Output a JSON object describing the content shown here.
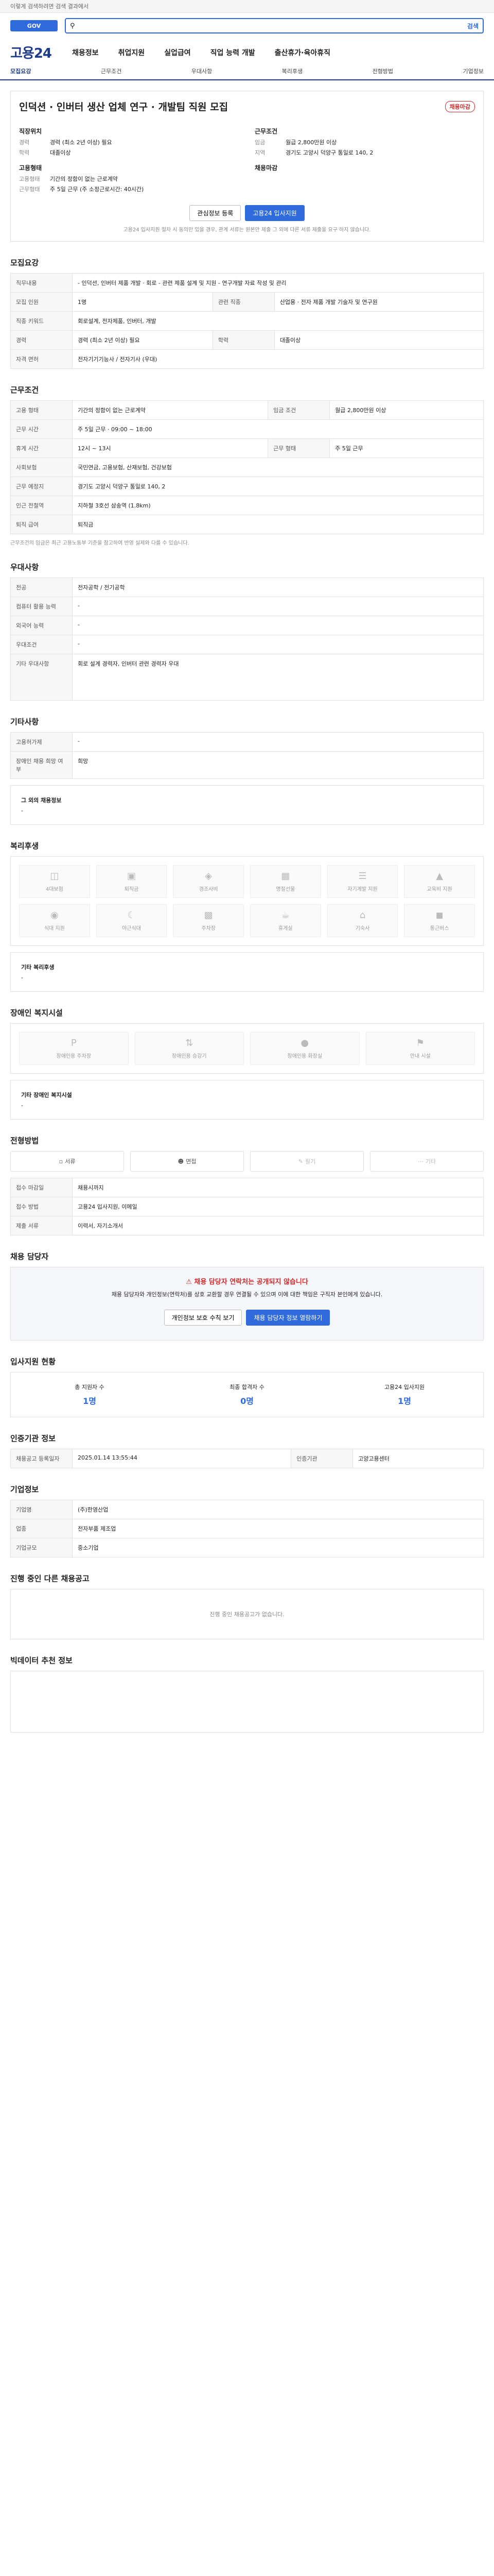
{
  "top_banner": "이렇게 검색하려면 검색 결과에서",
  "search": {
    "button_label": "검색",
    "placeholder": ""
  },
  "brand": "고용24",
  "gnb": [
    "채용정보",
    "취업지원",
    "실업급여",
    "직업 능력 개발",
    "출산휴가·육아휴직"
  ],
  "subnav": [
    "모집요강",
    "근무조건",
    "우대사항",
    "복리후생",
    "전형방법",
    "기업정보"
  ],
  "job": {
    "title": "인덕션 · 인버터 생산 업체 연구 · 개발팀 직원 모집",
    "status": "채용마감",
    "left": [
      {
        "k": "직장위치",
        "v": ""
      },
      {
        "k": "경력",
        "v": "경력 (최소 2년 이상) 필요"
      },
      {
        "k": "학력",
        "v": "대졸이상"
      }
    ],
    "left_group_1": "고용형태",
    "left_group_1_items": [
      {
        "k": "고용형태",
        "v": "기간의 정함이 없는 근로계약"
      },
      {
        "k": "근무형태",
        "v": "주 5일 근무 (주 소정근로시간: 40시간)"
      }
    ],
    "right_group": "근무조건",
    "right_items": [
      {
        "k": "임금",
        "v": "월급 2,800만원 이상"
      },
      {
        "k": "지역",
        "v": "경기도 고양시 덕양구 통일로 140, 2"
      }
    ],
    "right_group_2": "채용마감",
    "button_interest": "관심정보 등록",
    "button_apply": "고용24 입사지원",
    "note": "고용24 입사지원 절차 시 동의만 있을 경우, 관계 서류는 원본만 제출 그 외에 다른 서류 제출을 요구 하지 않습니다."
  },
  "recruit": {
    "heading": "모집요강",
    "rows": [
      {
        "th": "직무내용",
        "td": "- 인덕션, 인버터 제품 개발 · 회로 - 관련 제품 설계 및 지원 - 연구개발 자료 작성 및 관리"
      },
      {
        "th": "모집 인원",
        "td": "1명"
      },
      {
        "th": "관련 직종",
        "td": "산업용 · 전자 제품 개발 기술자 및 연구원"
      },
      {
        "th": "직종 키워드",
        "td": "회로설계, 전자제품, 인버터, 개발"
      },
      {
        "th": "경력",
        "td": "경력 (최소 2년 이상) 필요"
      },
      {
        "th": "학력",
        "td": "대졸이상"
      },
      {
        "th": "자격 면허",
        "td": "전자기기기능사 / 전자기사 (우대)"
      }
    ]
  },
  "work": {
    "heading": "근무조건",
    "rows": [
      {
        "th": "고용 형태",
        "td": "기간의 정함이 없는 근로계약"
      },
      {
        "th": "임금 조건",
        "td": "월급 2,800만원 이상"
      },
      {
        "th": "근무 시간",
        "td": "주 5일 근무 · 09:00 ~ 18:00"
      },
      {
        "th": "휴게 시간",
        "td": "12시 ~ 13시"
      },
      {
        "th": "근무 형태",
        "td": "주 5일 근무"
      },
      {
        "th": "사회보험",
        "td": "국민연금, 고용보험, 산재보험, 건강보험"
      },
      {
        "th": "근무 예정지",
        "td": "경기도 고양시 덕양구 통일로 140, 2"
      },
      {
        "th": "인근 전철역",
        "td": "지하철 3호선 삼송역 (1.8km)"
      },
      {
        "th": "퇴직 급여",
        "td": "퇴직금"
      }
    ],
    "note": "근무조건의 임금은 최근 고용노동부 기준을 참고하여 반영 실제와 다를 수 있습니다."
  },
  "prefer": {
    "heading": "우대사항",
    "rows": [
      {
        "th": "전공",
        "td": "전자공학 / 전기공학"
      },
      {
        "th": "컴퓨터 활용 능력",
        "td": "-"
      },
      {
        "th": "외국어 능력",
        "td": "-"
      },
      {
        "th": "우대조건",
        "td": "-"
      },
      {
        "th": "기타 우대사항",
        "td": "회로 설계 경력자, 인버터 관련 경력자 우대"
      }
    ]
  },
  "etc": {
    "heading": "기타사항",
    "rows": [
      {
        "th": "고용허가제",
        "td": "-"
      },
      {
        "th": "장애인 채용 희망 여부",
        "td": "희망"
      }
    ],
    "sub_heading": "그 외의 채용정보",
    "sub_value": "-"
  },
  "welfare": {
    "heading": "복리후생",
    "tiles": [
      "4대보험",
      "퇴직금",
      "경조사비",
      "명절선물",
      "자기계발 지원",
      "교육비 지원",
      "식대 지원",
      "야근식대",
      "주차장",
      "휴게실",
      "기숙사",
      "통근버스"
    ],
    "other_label": "기타 복리후생",
    "other_value": "-"
  },
  "disability": {
    "heading": "장애인 복지시설",
    "tiles": [
      "장애인용 주차장",
      "장애인용 승강기",
      "장애인용 화장실",
      "안내 시설"
    ],
    "other_label": "기타 장애인 복지시설",
    "other_value": "-"
  },
  "screening": {
    "heading": "전형방법",
    "tiles": [
      "서류",
      "면접",
      "필기",
      "기타"
    ],
    "rows": [
      {
        "th": "접수 마감일",
        "td": "채용시까지"
      },
      {
        "th": "접수 방법",
        "td": "고용24 입사지원, 이메일"
      },
      {
        "th": "제출 서류",
        "td": "이력서, 자기소개서"
      }
    ]
  },
  "contact": {
    "heading": "채용 담당자",
    "alert_title": "채용 담당자 연락처는 공개되지 않습니다",
    "alert_body": "채용 담당자와 개인정보(연락처)를 상호 교환할 경우 연결될 수 있으며 이에 대한 책임은 구직자 본인에게 있습니다.",
    "btn_1": "개인정보 보호 수칙 보기",
    "btn_2": "채용 담당자 정보 열람하기"
  },
  "applicants": {
    "heading": "입사지원 현황",
    "stats": [
      {
        "label": "총 지원자 수",
        "value": "1명"
      },
      {
        "label": "최종 합격자 수",
        "value": "0명"
      },
      {
        "label": "고용24 입사지원",
        "value": "1명"
      }
    ]
  },
  "info": {
    "heading": "인증기관 정보",
    "rows": [
      {
        "th": "채용공고 등록일자",
        "td": "2025.01.14 13:55:44"
      },
      {
        "th": "인증기관",
        "td": "고양고용센터"
      }
    ]
  },
  "company": {
    "heading": "기업정보",
    "rows": [
      {
        "th": "기업명",
        "td": "(주)한영산업"
      },
      {
        "th": "업종",
        "td": "전자부품 제조업"
      },
      {
        "th": "기업규모",
        "td": "중소기업"
      }
    ]
  },
  "other_jobs": {
    "heading": "진행 중인 다른 채용공고",
    "empty": "진행 중인 채용공고가 없습니다."
  },
  "recommend": {
    "heading": "빅데이터 추천 정보"
  }
}
